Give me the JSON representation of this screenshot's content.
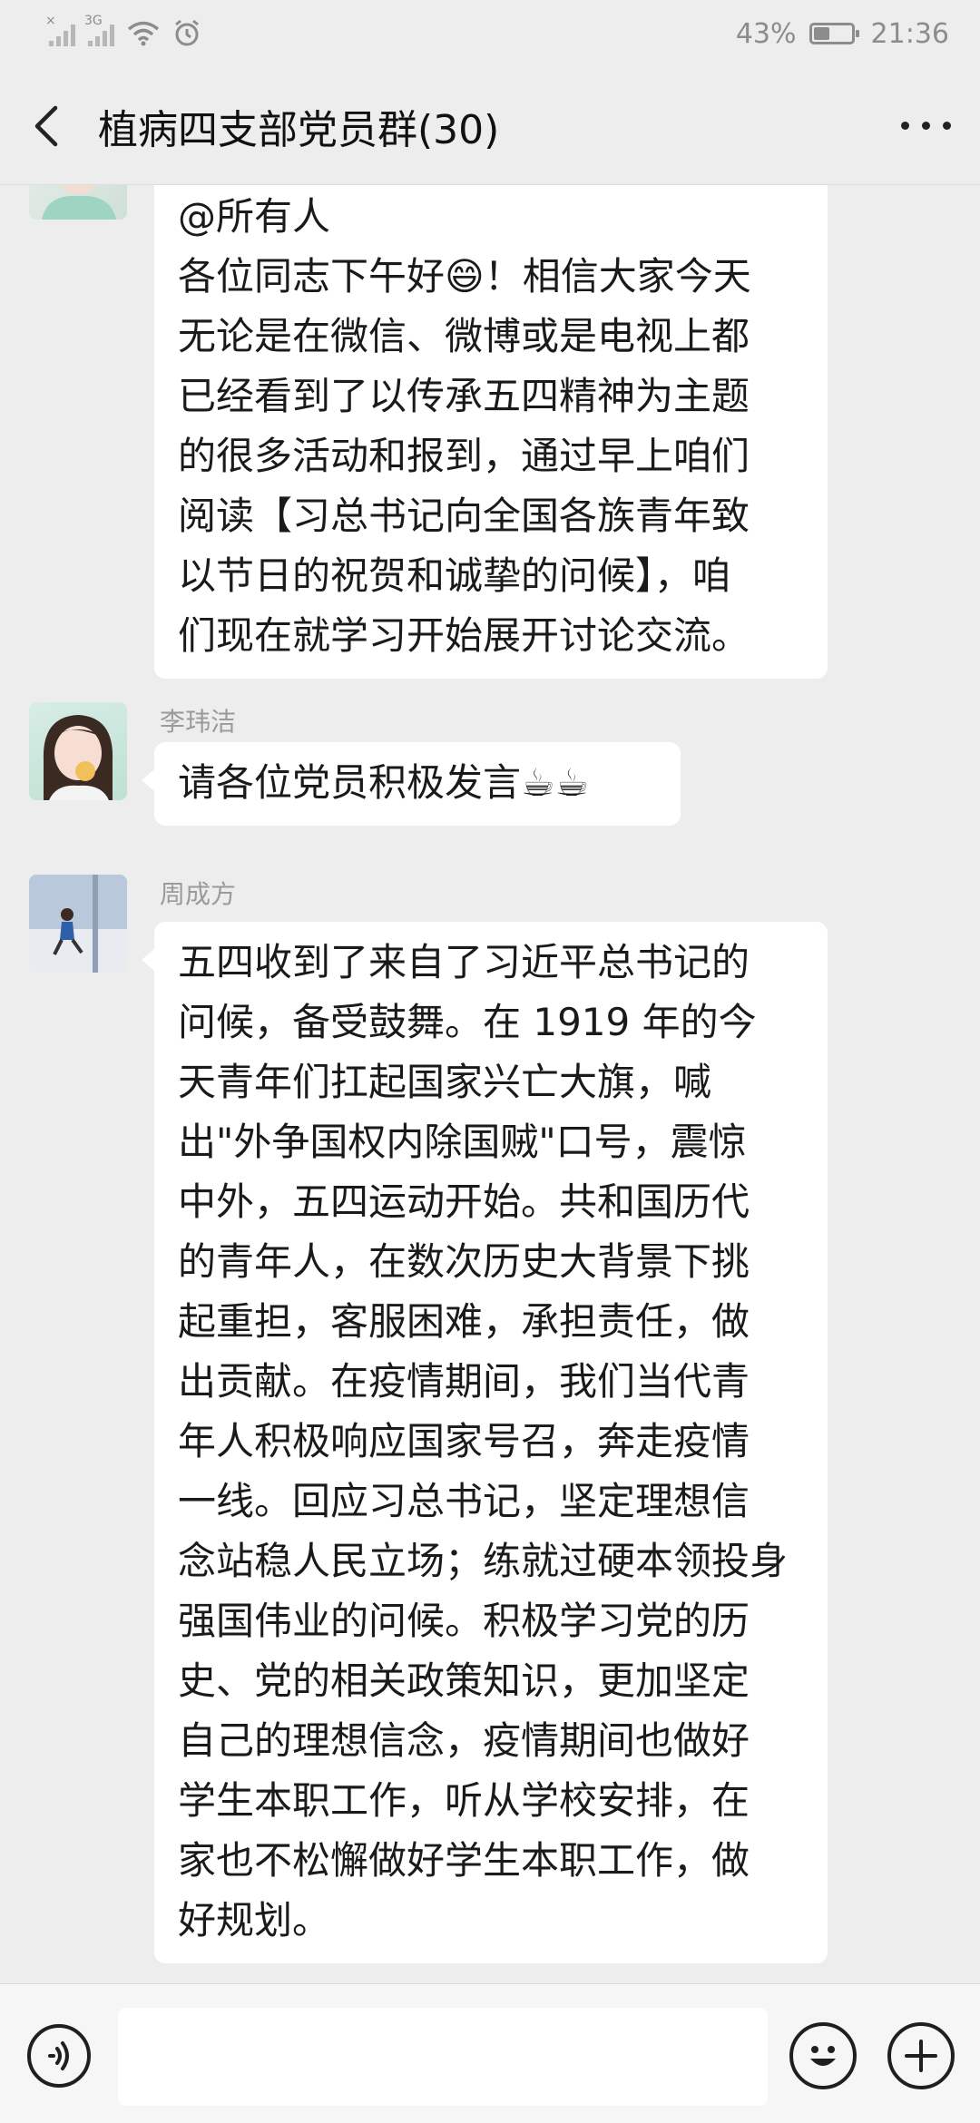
{
  "status_bar": {
    "signal_1_label": "×",
    "signal_2_label": "3G",
    "wifi_icon": "wifi-icon",
    "alarm_icon": "alarm-icon",
    "battery_percent_text": "43%",
    "battery_level": 0.43,
    "time": "21:36"
  },
  "header": {
    "back_icon": "chevron-left-icon",
    "title": "植病四支部党员群(30)",
    "more_icon": "more-dots-icon"
  },
  "messages": [
    {
      "sender": "",
      "text_lines": [
        "@所有人",
        "各位同志下午好😄！相信大家今天",
        "无论是在微信、微博或是电视上都",
        "已经看到了以传承五四精神为主题",
        "的很多活动和报到，通过早上咱们",
        "阅读【习总书记向全国各族青年致",
        "以节日的祝贺和诚挚的问候】，咱",
        "们现在就学习开始展开讨论交流。"
      ]
    },
    {
      "sender": "李玮洁",
      "text_lines": [
        "请各位党员积极发言☕☕"
      ]
    },
    {
      "sender": "周成方",
      "text_lines": [
        "五四收到了来自了习近平总书记的",
        "问候，备受鼓舞。在 1919 年的今",
        "天青年们扛起国家兴亡大旗，喊",
        "出\"外争国权内除国贼\"口号，震惊",
        "中外，五四运动开始。共和国历代",
        "的青年人，在数次历史大背景下挑",
        "起重担，客服困难，承担责任，做",
        "出贡献。在疫情期间，我们当代青",
        "年人积极响应国家号召，奔走疫情",
        "一线。回应习总书记，坚定理想信",
        "念站稳人民立场；练就过硬本领投身",
        "强国伟业的问候。积极学习党的历",
        "史、党的相关政策知识，更加坚定",
        "自己的理想信念，疫情期间也做好",
        "学生本职工作，听从学校安排，在",
        "家也不松懈做好学生本职工作，做",
        "好规划。"
      ]
    }
  ],
  "input_bar": {
    "voice_icon": "voice-icon",
    "text_value": "",
    "emoji_icon": "emoji-icon",
    "plus_icon": "plus-icon"
  }
}
